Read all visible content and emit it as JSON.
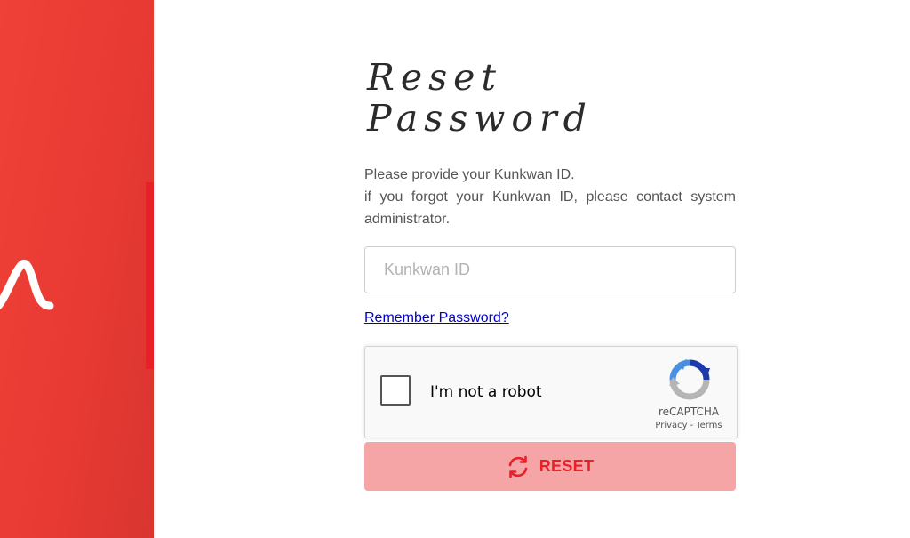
{
  "page": {
    "title_line1": "Reset",
    "title_line2": "Password",
    "description_line1": "Please provide your Kunkwan ID.",
    "description_line2": "if you forgot your Kunkwan ID, please contact system administrator."
  },
  "form": {
    "id_placeholder": "Kunkwan ID",
    "id_value": "",
    "remember_link": "Remember Password?",
    "reset_label": "RESET"
  },
  "recaptcha": {
    "checkbox_label": "I'm not a robot",
    "brand": "reCAPTCHA",
    "privacy": "Privacy",
    "separator": "-",
    "terms": "Terms"
  },
  "icons": {
    "brand_logo": "brand-swoosh-logo",
    "recaptcha_logo": "recaptcha-logo",
    "reset_icon": "refresh-icon"
  },
  "colors": {
    "brand_red": "#e8202a",
    "panel_red": "#ef4136",
    "reset_bg": "#f6a5a6",
    "link": "#0000cc"
  }
}
